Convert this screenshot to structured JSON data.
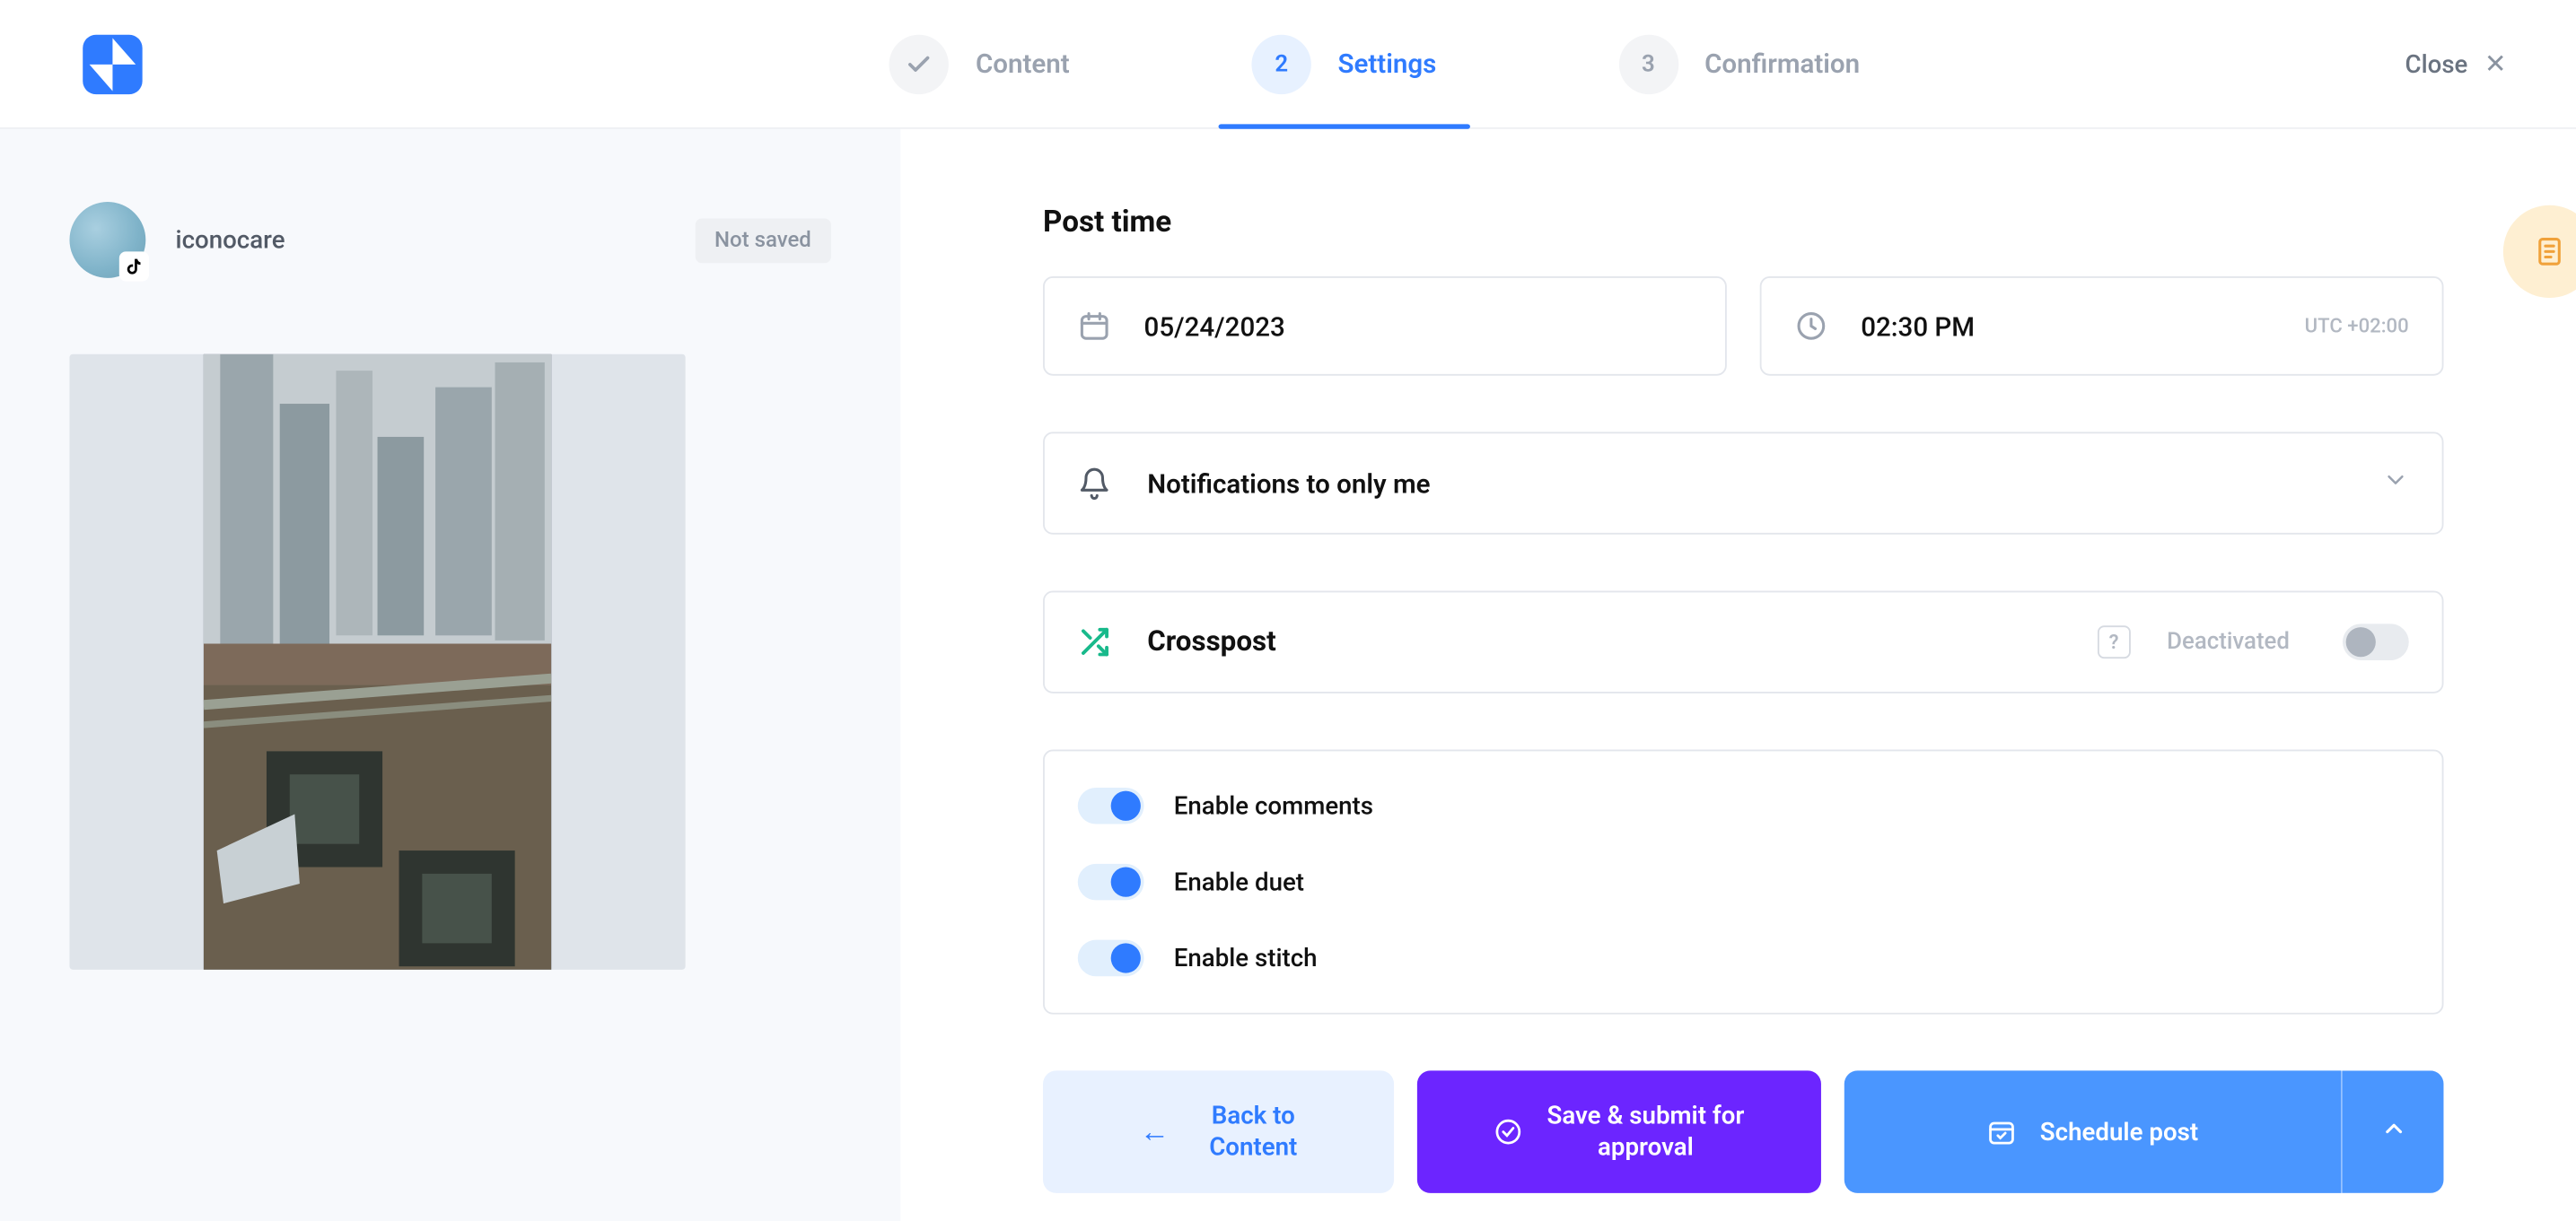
{
  "header": {
    "steps": [
      {
        "label": "Content",
        "indicator": "check"
      },
      {
        "label": "Settings",
        "indicator": "2"
      },
      {
        "label": "Confirmation",
        "indicator": "3"
      }
    ],
    "close_label": "Close"
  },
  "preview": {
    "username": "iconocare",
    "status": "Not saved"
  },
  "main": {
    "post_time_title": "Post time",
    "date_value": "05/24/2023",
    "time_value": "02:30 PM",
    "timezone": "UTC +02:00",
    "notifications_label": "Notifications to only me",
    "crosspost": {
      "label": "Crosspost",
      "help": "?",
      "state_label": "Deactivated"
    },
    "toggles": [
      {
        "label": "Enable comments",
        "on": true
      },
      {
        "label": "Enable duet",
        "on": true
      },
      {
        "label": "Enable stitch",
        "on": true
      }
    ]
  },
  "actions": {
    "back_line1": "Back to",
    "back_line2": "Content",
    "submit_line1": "Save & submit for",
    "submit_line2": "approval",
    "schedule": "Schedule post"
  }
}
